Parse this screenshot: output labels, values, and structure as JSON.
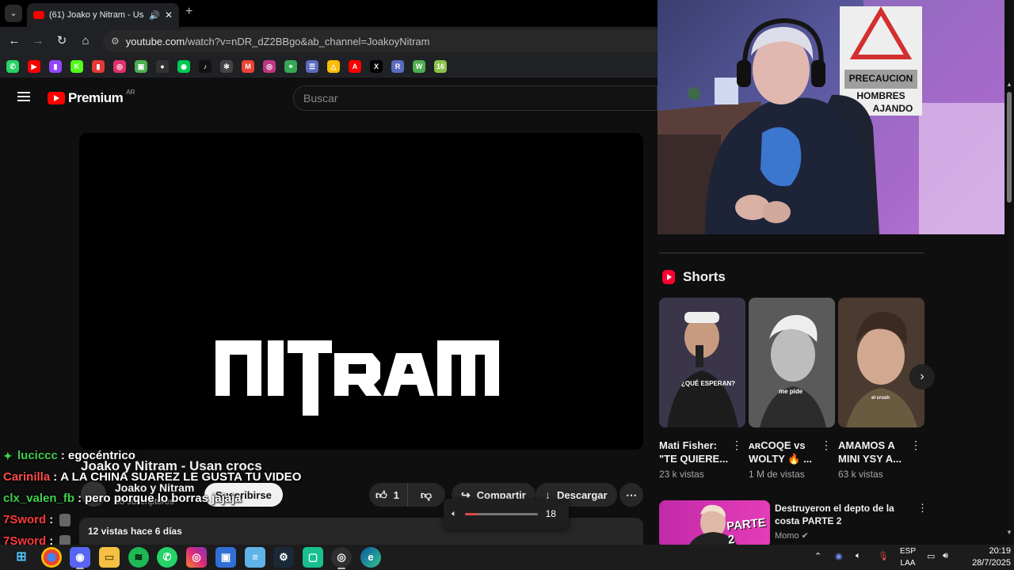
{
  "browser": {
    "tab_title": "(61) Joako y Nitram - Usan",
    "new_tab": "+",
    "url_host": "youtube.com",
    "url_path": "/watch?v=nDR_dZ2BBgo&ab_channel=JoakoyNitram",
    "bookmarks": [
      {
        "name": "whatsapp",
        "color": "#25d366",
        "glyph": "✆"
      },
      {
        "name": "youtube",
        "color": "#ff0000",
        "glyph": "▶"
      },
      {
        "name": "twitch",
        "color": "#9146ff",
        "glyph": "▮"
      },
      {
        "name": "kick",
        "color": "#53fc18",
        "glyph": "K"
      },
      {
        "name": "bookmark-red",
        "color": "#e53935",
        "glyph": "▮"
      },
      {
        "name": "instagram",
        "color": "#e1306c",
        "glyph": "◎"
      },
      {
        "name": "image-tool",
        "color": "#4caf50",
        "glyph": "▣"
      },
      {
        "name": "github",
        "color": "#333333",
        "glyph": "●"
      },
      {
        "name": "circle-tool",
        "color": "#00c853",
        "glyph": "◉"
      },
      {
        "name": "tiktok",
        "color": "#111111",
        "glyph": "♪"
      },
      {
        "name": "chatgpt",
        "color": "#444444",
        "glyph": "✻"
      },
      {
        "name": "gmail",
        "color": "#ea4335",
        "glyph": "M"
      },
      {
        "name": "instagram-2",
        "color": "#c13584",
        "glyph": "◎"
      },
      {
        "name": "maps",
        "color": "#34a853",
        "glyph": "⌖"
      },
      {
        "name": "list-tool",
        "color": "#5c6bc0",
        "glyph": "☰"
      },
      {
        "name": "drive",
        "color": "#fbbc04",
        "glyph": "△"
      },
      {
        "name": "adobe",
        "color": "#ff0000",
        "glyph": "A"
      },
      {
        "name": "x",
        "color": "#000000",
        "glyph": "X"
      },
      {
        "name": "r-tool",
        "color": "#5c6bc0",
        "glyph": "R"
      },
      {
        "name": "w-tool",
        "color": "#4caf50",
        "glyph": "W"
      },
      {
        "name": "sixteen",
        "color": "#8bc34a",
        "glyph": "16"
      }
    ]
  },
  "youtube": {
    "logo_word": "Premium",
    "country": "AR",
    "search_placeholder": "Buscar",
    "player_logo_text": "NITRAM",
    "video_title": "Joako y Nitram - Usan crocs",
    "channel_name": "Joako y Nitram",
    "subscribers": "38 suscriptores",
    "subscribe_label": "Suscribirse",
    "like_count": "1",
    "share_label": "Compartir",
    "download_label": "Descargar",
    "more_glyph": "⋯",
    "description_meta": "12 vistas  hace 6 días",
    "volume": {
      "value": "18",
      "level": 0.18
    }
  },
  "webcam": {
    "sign_line1": "PRECAUCION",
    "sign_line2": "HOMBRES",
    "sign_line3": "AJANDO"
  },
  "shorts": {
    "heading": "Shorts",
    "items": [
      {
        "title": "Mati Fisher: \"TE QUIERE...",
        "views": "23 k vistas",
        "caption": "¿QUÉ ESPERAN?"
      },
      {
        "title": "ᴀʀCOQE vs WOLTY 🔥 ...",
        "views": "1 M de vistas",
        "caption": "me pide"
      },
      {
        "title": "AMAMOS A MINI YSY A...",
        "views": "63 k vistas",
        "caption": "el crush"
      }
    ]
  },
  "recommended": {
    "title": "Destruyeron el depto de la costa PARTE 2",
    "channel": "Momo",
    "thumb_text": "PARTE 2"
  },
  "chat": [
    {
      "user": "luciccc",
      "color": "#3fd04e",
      "message": "egocéntrico",
      "badge": true
    },
    {
      "user": "Carinilla",
      "color": "#ff4d4d",
      "message": "A LA CHINA SUAREZ LE GUSTA TU VIDEO",
      "badge": false
    },
    {
      "user": "clx_valen_fb",
      "color": "#3fd04e",
      "message": "pero porque lo borras jajaja",
      "badge": false
    },
    {
      "user": "7Sword",
      "color": "#ff3b3b",
      "message": "",
      "badge": false
    },
    {
      "user": "7Sword",
      "color": "#ff3b3b",
      "message": "",
      "badge": false
    },
    {
      "user": "7Sword",
      "color": "#ff3b3b",
      "message": "",
      "badge": false
    }
  ],
  "taskbar": {
    "apps": [
      "windows-start",
      "chrome",
      "discord",
      "file-explorer",
      "spotify",
      "whatsapp",
      "instagram",
      "remote-desktop",
      "notepad",
      "steam",
      "game-app",
      "obs",
      "edge"
    ],
    "lang_line1": "ESP",
    "lang_line2": "LAA",
    "time": "20:19",
    "date": "28/7/2025"
  }
}
